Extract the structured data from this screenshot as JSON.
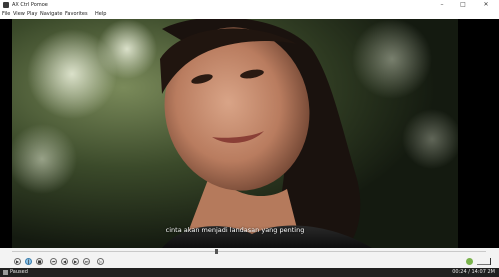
{
  "window": {
    "title": "AX Ctrl Pomoe",
    "minimize_glyph": "–",
    "maximize_glyph": "□",
    "close_glyph": "✕"
  },
  "menu": {
    "items": [
      "File",
      "View",
      "Play",
      "Navigate",
      "Favorites",
      "Help"
    ]
  },
  "video": {
    "subtitle": "cinta akan menjadi landasan yang penting"
  },
  "seek": {
    "progress": 0.43
  },
  "controls": {
    "buttons": [
      {
        "name": "play-icon",
        "glyph": "▶",
        "active": false
      },
      {
        "name": "pause-icon",
        "glyph": "‖",
        "active": true
      },
      {
        "name": "stop-icon",
        "glyph": "■",
        "active": false
      },
      {
        "name": "prev-icon",
        "glyph": "⏮",
        "active": false
      },
      {
        "name": "rewind-icon",
        "glyph": "◀",
        "active": false
      },
      {
        "name": "forward-icon",
        "glyph": "▶",
        "active": false
      },
      {
        "name": "next-icon",
        "glyph": "⏭",
        "active": false
      },
      {
        "name": "frame-step-icon",
        "glyph": "▷",
        "active": false
      }
    ],
    "volume_level": 1.0
  },
  "status": {
    "state": "Paused",
    "time": "00:24 / 14:07  2M"
  }
}
